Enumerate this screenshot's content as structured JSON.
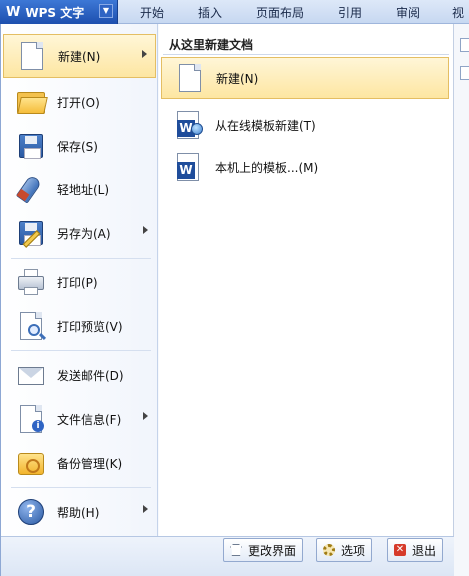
{
  "app": {
    "title": "WPS 文字",
    "logo": "W"
  },
  "ribbon_tabs": [
    "开始",
    "插入",
    "页面布局",
    "引用",
    "审阅",
    "视"
  ],
  "left_menu": [
    {
      "label": "新建(N)",
      "icon": "new-document-icon",
      "submenu": true,
      "active": true
    },
    {
      "label": "打开(O)",
      "icon": "open-folder-icon",
      "submenu": false
    },
    {
      "label": "保存(S)",
      "icon": "save-icon",
      "submenu": false
    },
    {
      "label": "轻地址(L)",
      "icon": "rocket-icon",
      "submenu": false
    },
    {
      "label": "另存为(A)",
      "icon": "save-as-icon",
      "submenu": true
    },
    {
      "label": "打印(P)",
      "icon": "printer-icon",
      "submenu": false
    },
    {
      "label": "打印预览(V)",
      "icon": "print-preview-icon",
      "submenu": false
    },
    {
      "label": "发送邮件(D)",
      "icon": "mail-icon",
      "submenu": false
    },
    {
      "label": "文件信息(F)",
      "icon": "file-info-icon",
      "submenu": true
    },
    {
      "label": "备份管理(K)",
      "icon": "backup-icon",
      "submenu": false
    },
    {
      "label": "帮助(H)",
      "icon": "help-icon",
      "submenu": true
    }
  ],
  "submenu": {
    "heading": "从这里新建文档",
    "items": [
      {
        "label": "新建(N)",
        "icon": "blank-document-icon",
        "active": true
      },
      {
        "label": "从在线模板新建(T)",
        "icon": "online-template-icon"
      },
      {
        "label": "本机上的模板...(M)",
        "icon": "local-template-icon"
      }
    ]
  },
  "bottom_buttons": [
    {
      "label": "更改界面",
      "icon": "shirt-icon"
    },
    {
      "label": "选项",
      "icon": "options-gear-icon"
    },
    {
      "label": "退出",
      "icon": "exit-icon"
    }
  ]
}
